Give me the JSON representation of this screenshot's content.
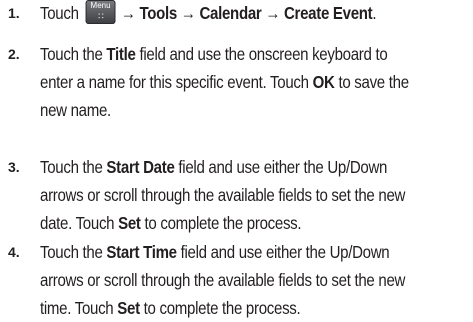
{
  "steps": [
    {
      "number": "1.",
      "lines": [
        [
          {
            "t": "Touch "
          },
          {
            "icon": "menu-key",
            "label": "Menu",
            "glyph": "∷"
          },
          {
            "t": " → Tools → Calendar → Create Event",
            "b": true
          },
          {
            "t": "."
          }
        ]
      ]
    },
    {
      "number": "2.",
      "lines": [
        [
          {
            "t": "Touch the "
          },
          {
            "t": "Title",
            "b": true
          },
          {
            "t": " field and use the onscreen keyboard to"
          }
        ],
        [
          {
            "t": "enter a name for this specific event. Touch "
          },
          {
            "t": "OK",
            "b": true
          },
          {
            "t": " to save the"
          }
        ],
        [
          {
            "t": "new name."
          }
        ]
      ]
    },
    {
      "number": "3.",
      "lines": [
        [
          {
            "t": "Touch the "
          },
          {
            "t": "Start Date",
            "b": true
          },
          {
            "t": " field and use either the Up/Down"
          }
        ],
        [
          {
            "t": "arrows or scroll through the available fields to set the new"
          }
        ],
        [
          {
            "t": "date. Touch "
          },
          {
            "t": "Set",
            "b": true
          },
          {
            "t": " to complete the process."
          }
        ]
      ]
    },
    {
      "number": "4.",
      "lines": [
        [
          {
            "t": "Touch the "
          },
          {
            "t": "Start Time",
            "b": true
          },
          {
            "t": " field and use either the Up/Down"
          }
        ],
        [
          {
            "t": "arrows or scroll through the available fields to set the new"
          }
        ],
        [
          {
            "t": "time. Touch "
          },
          {
            "t": "Set",
            "b": true
          },
          {
            "t": " to complete the process."
          }
        ]
      ]
    }
  ]
}
